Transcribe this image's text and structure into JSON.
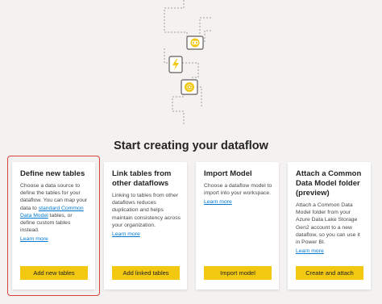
{
  "page": {
    "title": "Start creating your dataflow"
  },
  "illustration": {
    "nodes": [
      {
        "icon": "link-icon",
        "color": "#f2c811"
      },
      {
        "icon": "lightning-icon",
        "color": "#f2c811"
      },
      {
        "icon": "gear-icon",
        "color": "#f2c811"
      }
    ]
  },
  "cards": [
    {
      "title": "Define new tables",
      "desc_before": "Choose a data source to define the tables for your dataflow. You can map your data to ",
      "desc_link": "standard Common Data Model",
      "desc_after": " tables, or define custom tables instead.",
      "learn_more": "Learn more",
      "button": "Add new tables",
      "highlighted": true
    },
    {
      "title": "Link tables from other dataflows",
      "desc": "Linking to tables from other dataflows reduces duplication and helps maintain consistency across your organization.",
      "learn_more": "Learn more",
      "button": "Add linked tables"
    },
    {
      "title": "Import Model",
      "desc": "Choose a dataflow model to import into your workspace.",
      "learn_more": "Learn more",
      "button": "Import model"
    },
    {
      "title": "Attach a Common Data Model folder (preview)",
      "desc": "Attach a Common Data Model folder from your Azure Data Lake Storage Gen2 account to a new dataflow, so you can use it in Power BI.",
      "learn_more": "Learn more",
      "button": "Create and attach"
    }
  ],
  "colors": {
    "accent": "#f2c811",
    "link": "#0078d4",
    "highlight": "#d9413c"
  }
}
